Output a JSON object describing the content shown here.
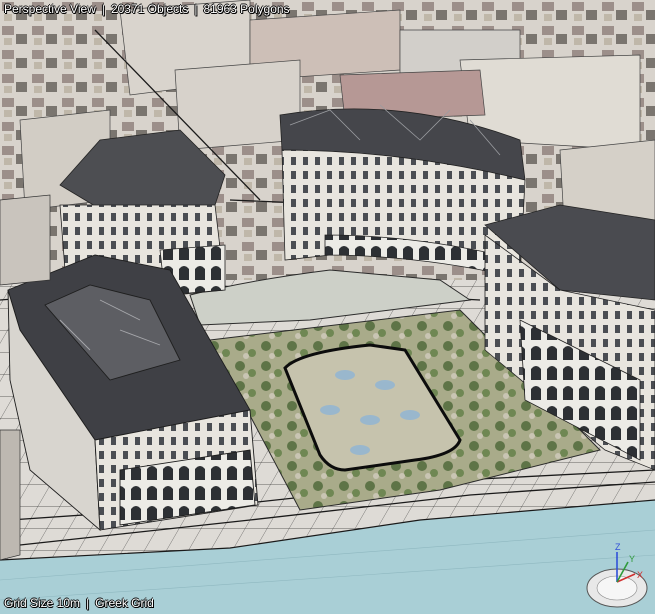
{
  "viewport": {
    "view_name": "Perspective View",
    "objects": "20371 Objects",
    "polygons": "81963 Polygons",
    "separator": "|",
    "grid_size": "Grid Size 10m",
    "grid_name": "Greek Grid"
  },
  "gizmo": {
    "axis_z": "Z",
    "axis_y": "Y",
    "axis_x": "X"
  },
  "colors": {
    "sea": "#a9cfd6",
    "wireframe": "#1a1a1a",
    "roof": "#3e3e42",
    "facade": "#e9e6e0",
    "plaza": "#b8b9a0",
    "axis_x": "#d03030",
    "axis_y": "#2f9a3a",
    "axis_z": "#3050d8"
  }
}
